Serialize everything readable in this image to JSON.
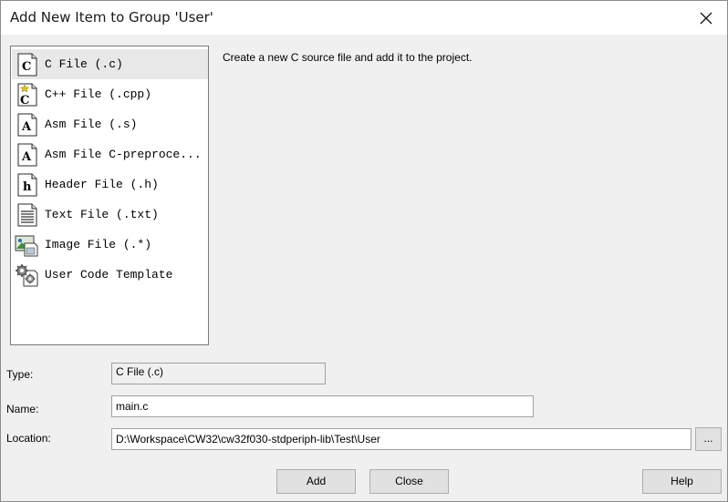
{
  "window": {
    "title": "Add New Item to Group 'User'",
    "close_icon": "close-icon"
  },
  "item_list": {
    "selected_index": 0,
    "items": [
      {
        "label": "C File (.c)",
        "icon": "c-file-icon"
      },
      {
        "label": "C++ File (.cpp)",
        "icon": "cpp-file-icon"
      },
      {
        "label": "Asm File (.s)",
        "icon": "asm-file-icon"
      },
      {
        "label": "Asm File C-preproce...",
        "icon": "asm-preproc-file-icon"
      },
      {
        "label": "Header File (.h)",
        "icon": "header-file-icon"
      },
      {
        "label": "Text File (.txt)",
        "icon": "text-file-icon"
      },
      {
        "label": "Image File (.*)",
        "icon": "image-file-icon"
      },
      {
        "label": "User Code Template",
        "icon": "gears-icon"
      }
    ]
  },
  "description": "Create a new C source file and add it to the project.",
  "form": {
    "type_label": "Type:",
    "type_value": "C File (.c)",
    "name_label": "Name:",
    "name_value": "main.c",
    "location_label": "Location:",
    "location_value": "D:\\Workspace\\CW32\\cw32f030-stdperiph-lib\\Test\\User",
    "browse_label": "..."
  },
  "buttons": {
    "add": "Add",
    "close": "Close",
    "help": "Help"
  },
  "colors": {
    "dialog_bg": "#f0f0f0",
    "titlebar_bg": "#ffffff",
    "selection_bg": "#e8e8e8"
  }
}
